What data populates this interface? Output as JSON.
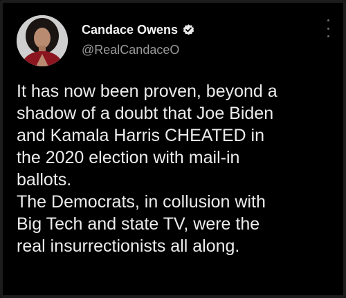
{
  "author": {
    "display_name": "Candace Owens",
    "handle": "@RealCandaceO",
    "verified": true,
    "avatar": "profile-photo"
  },
  "tweet": {
    "lines": [
      "It has now been proven, beyond a",
      "shadow of a doubt that Joe Biden",
      "and Kamala Harris CHEATED in",
      "the 2020 election with mail-in",
      "ballots.",
      "The Democrats, in collusion with",
      "Big Tech and state TV, were the",
      "real insurrectionists all along."
    ]
  },
  "icons": {
    "verified": "verified-badge-icon",
    "more": "more-options-icon"
  },
  "colors": {
    "background": "#000000",
    "text": "#ececec",
    "handle": "#9a9a9a",
    "verified": "#e9e9e9"
  }
}
